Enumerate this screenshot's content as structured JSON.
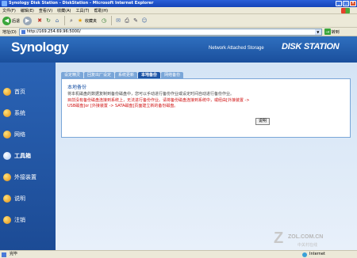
{
  "window": {
    "title": "Synology Disk Station - DiskStation - Microsoft Internet Explorer"
  },
  "menubar": [
    "文件(F)",
    "编辑(E)",
    "查看(V)",
    "收藏(A)",
    "工具(T)",
    "帮助(H)"
  ],
  "toolbar": {
    "back": "后退",
    "favorites": "收藏夹"
  },
  "address": {
    "label": "地址(D)",
    "url": "http://169.254.69.96:5000/",
    "go": "转到"
  },
  "header": {
    "logo": "Synology",
    "tagline": "Network Attached Storage",
    "brand": "DISK STATION"
  },
  "sidebar": {
    "items": [
      {
        "label": "首页"
      },
      {
        "label": "系统"
      },
      {
        "label": "网络"
      },
      {
        "label": "工具箱"
      },
      {
        "label": "外接装置"
      },
      {
        "label": "说明"
      },
      {
        "label": "注销"
      }
    ]
  },
  "tabs": [
    "设定精灵",
    "回复出厂设定",
    "系统更新",
    "本地备份",
    "网络备份"
  ],
  "panel": {
    "title": "本地备份",
    "description": "将本机磁盘的数据复制到备份磁盘中，您可以手动进行备份作业或设定时间自动进行备份作业。",
    "warning_line1": "目前没有备份磁盘连接到系统上，无法进行备份作业。请将备份磁盘连接到系统中，或经由[外接装置 ->",
    "warning_line2": "USB磁盘]or [外接装置 -> SATA磁盘]页面建立新的备份磁盘。",
    "button": "说明"
  },
  "watermark": {
    "site": "ZOL.COM.CN",
    "cn": "中关村在线"
  },
  "status": {
    "left": "完毕",
    "right": "Internet"
  }
}
